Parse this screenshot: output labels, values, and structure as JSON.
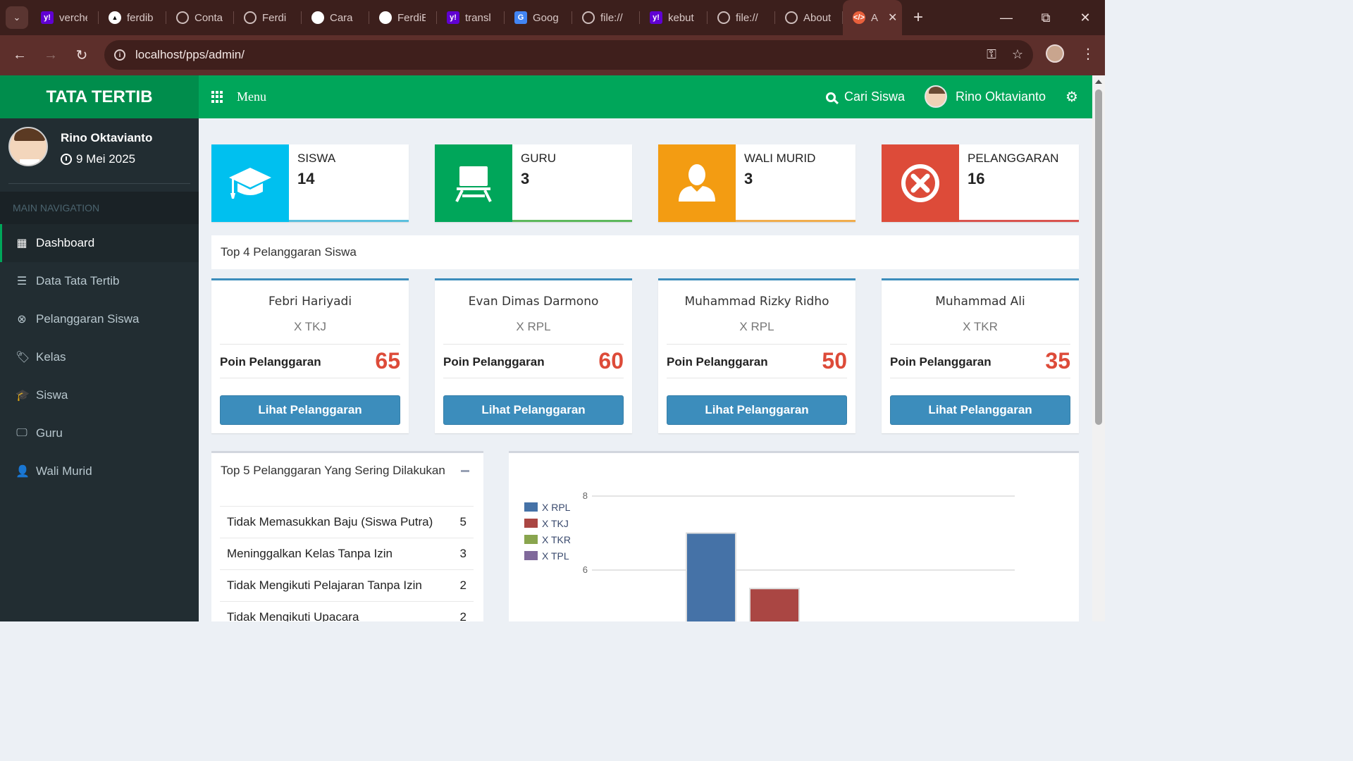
{
  "browser": {
    "tabs": [
      {
        "title": "verche",
        "icon": "yahoo-icon",
        "color": "#6001d2"
      },
      {
        "title": "ferdib",
        "icon": "vercel-icon",
        "color": "#000000"
      },
      {
        "title": "Conta",
        "icon": "globe-icon",
        "color": "#8a8a8a"
      },
      {
        "title": "Ferdi",
        "icon": "globe-icon",
        "color": "#8a8a8a"
      },
      {
        "title": "Cara",
        "icon": "openai-icon",
        "color": "#ffffff"
      },
      {
        "title": "FerdiE",
        "icon": "github-icon",
        "color": "#ffffff"
      },
      {
        "title": "transl",
        "icon": "yahoo-icon",
        "color": "#6001d2"
      },
      {
        "title": "Goog",
        "icon": "google-translate-icon",
        "color": "#4285f4"
      },
      {
        "title": "file://",
        "icon": "globe-icon",
        "color": "#8a8a8a"
      },
      {
        "title": "kebut",
        "icon": "yahoo-icon",
        "color": "#6001d2"
      },
      {
        "title": "file://",
        "icon": "globe-icon",
        "color": "#8a8a8a"
      },
      {
        "title": "About",
        "icon": "globe-icon",
        "color": "#8a8a8a"
      }
    ],
    "active_tab": {
      "title": "A",
      "icon": "code-icon",
      "color": "#e8603c"
    },
    "url": "localhost/pps/admin/"
  },
  "app": {
    "logo": "TATA TERTIB",
    "menu_label": "Menu",
    "search_label": "Cari Siswa",
    "user_name": "Rino Oktavianto"
  },
  "sidebar": {
    "user_name": "Rino Oktavianto",
    "date": "9 Mei 2025",
    "section_header": "MAIN NAVIGATION",
    "items": [
      {
        "label": "Dashboard",
        "icon": "grid-icon",
        "active": true
      },
      {
        "label": "Data Tata Tertib",
        "icon": "list-icon",
        "active": false
      },
      {
        "label": "Pelanggaran Siswa",
        "icon": "times-circle-icon",
        "active": false
      },
      {
        "label": "Kelas",
        "icon": "tags-icon",
        "active": false
      },
      {
        "label": "Siswa",
        "icon": "graduation-cap-icon",
        "active": false
      },
      {
        "label": "Guru",
        "icon": "desktop-icon",
        "active": false
      },
      {
        "label": "Wali Murid",
        "icon": "user-icon",
        "active": false
      }
    ]
  },
  "stats": [
    {
      "label": "SISWA",
      "value": "14",
      "color": "#00c0ef",
      "bar": "#5bc0de",
      "icon": "graduation-cap-icon"
    },
    {
      "label": "GURU",
      "value": "3",
      "color": "#00a65a",
      "bar": "#5cb85c",
      "icon": "chalkboard-icon"
    },
    {
      "label": "WALI MURID",
      "value": "3",
      "color": "#f39c12",
      "bar": "#f0ad4e",
      "icon": "user-icon"
    },
    {
      "label": "PELANGGARAN",
      "value": "16",
      "color": "#dd4b39",
      "bar": "#d9534f",
      "icon": "times-circle-icon"
    }
  ],
  "top_students": {
    "title": "Top 4 Pelanggaran Siswa",
    "poin_label": "Poin Pelanggaran",
    "button_label": "Lihat Pelanggaran",
    "students": [
      {
        "name": "Febri Hariyadi",
        "class": "X TKJ",
        "poin": "65"
      },
      {
        "name": "Evan Dimas Darmono",
        "class": "X RPL",
        "poin": "60"
      },
      {
        "name": "Muhammad Rizky Ridho",
        "class": "X RPL",
        "poin": "50"
      },
      {
        "name": "Muhammad Ali",
        "class": "X TKR",
        "poin": "35"
      }
    ]
  },
  "top_violations": {
    "title": "Top 5 Pelanggaran Yang Sering Dilakukan",
    "items": [
      {
        "label": "Tidak Memasukkan Baju (Siswa Putra)",
        "count": "5"
      },
      {
        "label": "Meninggalkan Kelas Tanpa Izin",
        "count": "3"
      },
      {
        "label": "Tidak Mengikuti Pelajaran Tanpa Izin",
        "count": "2"
      },
      {
        "label": "Tidak Mengikuti Upacara",
        "count": "2"
      }
    ]
  },
  "chart_data": {
    "type": "bar",
    "legend_position": "top-left",
    "grid": true,
    "y_ticks": [
      8,
      6
    ],
    "ylim_visible": [
      5.4,
      8.2
    ],
    "series": [
      {
        "name": "X RPL",
        "color": "#4572a7",
        "value": 7
      },
      {
        "name": "X TKJ",
        "color": "#aa4643",
        "value": 5.5
      },
      {
        "name": "X TKR",
        "color": "#89a54e",
        "value": null
      },
      {
        "name": "X TPL",
        "color": "#80699b",
        "value": null
      }
    ]
  }
}
